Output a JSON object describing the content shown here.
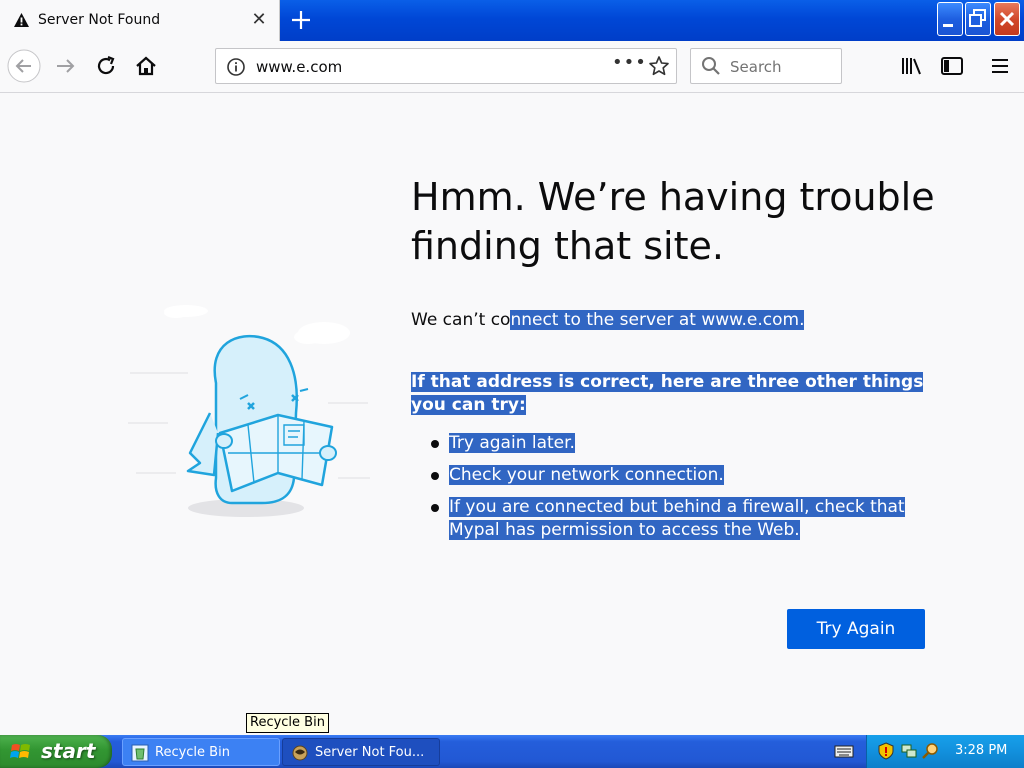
{
  "window": {
    "tab_title": "Server Not Found",
    "tab_close_glyph": "✕"
  },
  "navbar": {
    "url": "www.e.com",
    "search_placeholder": "Search",
    "page_actions_glyph": "•••"
  },
  "error_page": {
    "heading": "Hmm. We’re having trouble finding that site.",
    "desc_plain": "We can’t co",
    "desc_selected": "nnect to the server at www.e.com.",
    "subheading": "If that address is correct, here are three other things you can try:",
    "tips": [
      "Try again later.",
      "Check your network connection.",
      "If you are connected but behind a firewall, check that Mypal has permission to access the Web."
    ],
    "try_again_label": "Try Again"
  },
  "tooltip": "Recycle Bin",
  "taskbar": {
    "start_label": "start",
    "tasks": [
      {
        "label": "Recycle Bin",
        "icon": "recycle-bin-icon"
      },
      {
        "label": "Server Not Fou...",
        "icon": "mypal-icon"
      }
    ],
    "clock": "3:28 PM"
  },
  "colors": {
    "accent": "#0060df",
    "selection": "#3166c3",
    "titlebar": "#0047d6",
    "taskbar": "#245edb",
    "start_button": "#329632"
  }
}
